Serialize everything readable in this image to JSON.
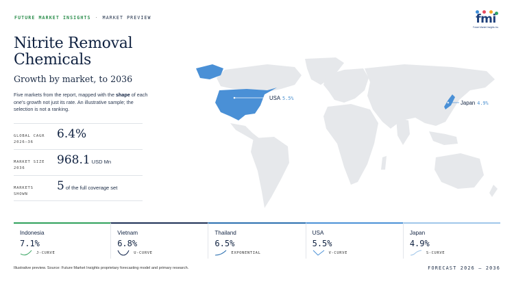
{
  "header": {
    "brand": "FUTURE MARKET INSIGHTS",
    "separator": "·",
    "section": "MARKET PREVIEW"
  },
  "logo": {
    "text": "fmi",
    "sub": "Future Market Insights Inc.",
    "dot_colors": [
      "#3c8dd9",
      "#e84a5f",
      "#f5a623",
      "#2ea66a"
    ]
  },
  "title": "Nitrite Removal Chemicals",
  "subtitle": "Growth by market, to 2036",
  "description": {
    "part1": "Five markets from the report, mapped with the ",
    "bold": "shape",
    "part2": " of each one's growth not just its rate. An illustrative sample; the selection is not a ranking."
  },
  "stats": [
    {
      "label_line1": "GLOBAL CAGR",
      "label_line2": "2026–36",
      "value": "6.4%",
      "unit": ""
    },
    {
      "label_line1": "MARKET SIZE",
      "label_line2": "2036",
      "value": "968.1",
      "unit": "USD Mn"
    },
    {
      "label_line1": "MARKETS",
      "label_line2": "SHOWN",
      "value": "5",
      "unit": "of the full coverage set"
    }
  ],
  "map": {
    "labels": [
      {
        "country": "USA",
        "pct": "5.5%"
      },
      {
        "country": "Japan",
        "pct": "4.9%"
      }
    ],
    "land_color": "#e6e8eb",
    "highlight_color": "#4a90d6"
  },
  "cards": [
    {
      "name": "Indonesia",
      "value": "7.1%",
      "curve": "J-CURVE",
      "color": "#2ea05a"
    },
    {
      "name": "Vietnam",
      "value": "6.8%",
      "curve": "U-CURVE",
      "color": "#1c2f55"
    },
    {
      "name": "Thailand",
      "value": "6.5%",
      "curve": "EXPONENTIAL",
      "color": "#2a6fb0"
    },
    {
      "name": "USA",
      "value": "5.5%",
      "curve": "V-CURVE",
      "color": "#4a90d6"
    },
    {
      "name": "Japan",
      "value": "4.9%",
      "curve": "S-CURVE",
      "color": "#9fc6ea"
    }
  ],
  "footer": {
    "source": "Illustrative preview. Source: Future Market Insights proprietary forecasting model and primary research.",
    "forecast": "FORECAST 2026 – 2036"
  }
}
